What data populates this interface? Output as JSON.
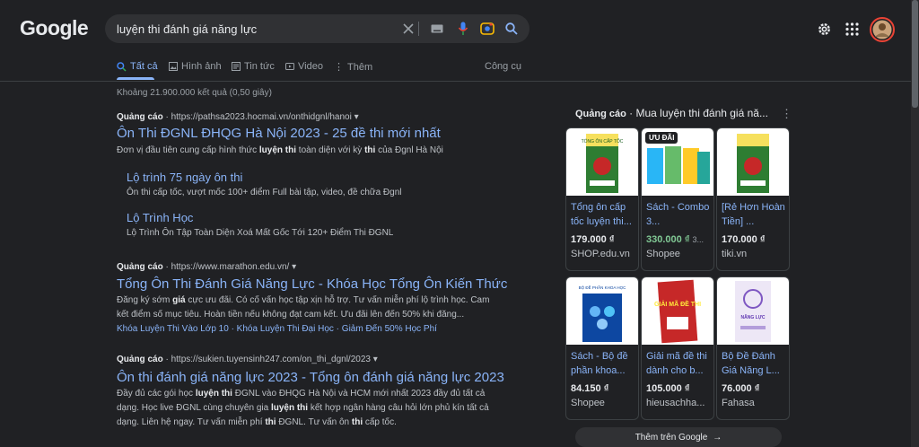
{
  "header": {
    "logo": "Google",
    "search_query": "luyện thi đánh giá năng lực"
  },
  "tabs": [
    {
      "label": "Tất cả"
    },
    {
      "label": "Hình ảnh"
    },
    {
      "label": "Tin tức"
    },
    {
      "label": "Video"
    },
    {
      "label": "Thêm"
    }
  ],
  "tools_label": "Công cụ",
  "result_stats": "Khoảng 21.900.000 kết quả (0,50 giây)",
  "ad_label": "Quảng cáo",
  "results": [
    {
      "url": "https://pathsa2023.hocmai.vn/onthidgnl/hanoi",
      "title": "Ôn Thi ĐGNL ĐHQG Hà Nội 2023 - 25 đề thi mới nhất",
      "desc_pre": "Đơn vị đầu tiên cung cấp hình thức ",
      "desc_b1": "luyện thi",
      "desc_mid": " toàn diện với kỳ ",
      "desc_b2": "thi",
      "desc_post": " của Đgnl Hà Nội",
      "sitelinks": [
        {
          "title": "Lộ trình 75 ngày ôn thi",
          "desc": "Ôn thi cấp tốc, vượt mốc 100+ điểm Full bài tập, video, đề chữa Đgnl"
        },
        {
          "title": "Lộ Trình Học",
          "desc": "Lộ Trình Ôn Tập Toàn Diện Xoá Mất Gốc Tới 120+ Điểm Thi ĐGNL"
        }
      ]
    },
    {
      "url": "https://www.marathon.edu.vn/",
      "title": "Tổng Ôn Thi Đánh Giá Năng Lực - Khóa Học Tổng Ôn Kiến Thức",
      "desc_line1_pre": "Đăng ký sớm ",
      "desc_line1_b": "giá",
      "desc_line1_post": " cực ưu đãi. Có cố vấn học tập xịn hỗ trợ. Tư vấn miễn phí lộ trình học. Cam",
      "desc_line2": "kết điểm số mục tiêu. Hoàn tiền nếu không đạt cam kết. Ưu đãi lên đến 50% khi đăng...",
      "links": "Khóa Luyện Thi Vào Lớp 10 · Khóa Luyện Thi Đại Học · Giảm Đến 50% Học Phí"
    },
    {
      "url": "https://sukien.tuyensinh247.com/on_thi_dgnl/2023",
      "title": "Ôn thi đánh giá năng lực 2023 - Tổng ôn đánh giá năng lực 2023",
      "l1_pre": "Đầy đủ các gói học ",
      "l1_b": "luyện thi",
      "l1_post": " ĐGNL vào ĐHQG Hà Nội và HCM mới nhất 2023 đầy đủ tất cả",
      "l2_pre": "dạng. Học live ĐGNL cùng chuyên gia ",
      "l2_b": "luyện thi",
      "l2_post": " kết hợp ngân hàng câu hỏi lớn phủ kín tất cả",
      "l3_pre": "dạng. Liên hệ ngay. Tư vấn miễn phí ",
      "l3_b": "thi",
      "l3_mid": " ĐGNL. Tư vấn ôn ",
      "l3_b2": "thi",
      "l3_post": " cấp tốc."
    }
  ],
  "shopping": {
    "ad_label": "Quảng cáo",
    "title": " · Mua luyện thi đánh giá nă...",
    "more_label": "Thêm trên Google",
    "products": [
      {
        "name": "Tổng ôn cấp tốc luyện thi...",
        "price": "179.000 ₫",
        "store": "SHOP.edu.vn"
      },
      {
        "name": "Sách - Combo 3...",
        "price": "330.000 ₫",
        "old_price": "3...",
        "store": "Shopee",
        "badge": "ƯU ĐÃI"
      },
      {
        "name": "[Rẻ Hơn Hoàn Tiền] ...",
        "price": "170.000 ₫",
        "store": "tiki.vn"
      },
      {
        "name": "Sách - Bộ đề phần khoa...",
        "price": "84.150 ₫",
        "store": "Shopee"
      },
      {
        "name": "Giải mã đề thi dành cho b...",
        "price": "105.000 ₫",
        "store": "hieusachha..."
      },
      {
        "name": "Bộ Đề Đánh Giá Năng L...",
        "price": "76.000 ₫",
        "store": "Fahasa"
      }
    ],
    "cover_texts": [
      "TỔNG ÔN CẤP TỐC",
      "BỘ ĐỀ PHẦN KHOA HỌC",
      "GIẢI MÃ ĐỀ THI",
      "NĂNG LỰC"
    ]
  },
  "colors": {
    "background": "#202124",
    "link": "#8ab4f8",
    "text": "#bdc1c6",
    "sale": "#81c995"
  }
}
